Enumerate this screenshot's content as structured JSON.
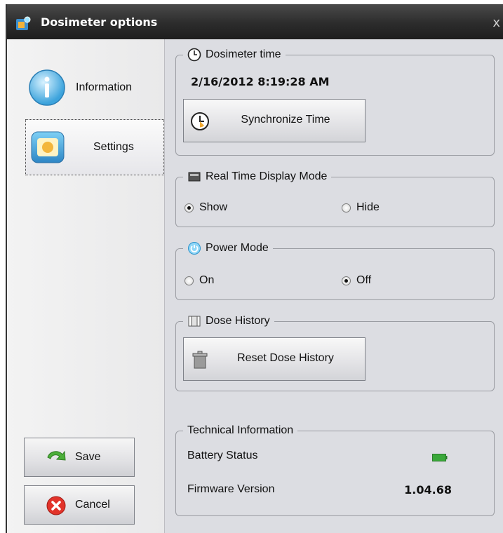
{
  "window": {
    "title": "Dosimeter options",
    "close_glyph": "x"
  },
  "sidebar": {
    "items": [
      {
        "label": "Information",
        "icon": "info-icon",
        "selected": false
      },
      {
        "label": "Settings",
        "icon": "settings-icon",
        "selected": true
      }
    ]
  },
  "buttons": {
    "save_label": "Save",
    "cancel_label": "Cancel"
  },
  "dosimeter_time": {
    "title": "Dosimeter time",
    "value": "2/16/2012 8:19:28 AM",
    "sync_button": "Synchronize Time"
  },
  "realtime_display": {
    "title": "Real Time Display Mode",
    "options": [
      "Show",
      "Hide"
    ],
    "selected": "Show"
  },
  "power_mode": {
    "title": "Power Mode",
    "options": [
      "On",
      "Off"
    ],
    "selected": "Off"
  },
  "dose_history": {
    "title": "Dose History",
    "reset_button": "Reset Dose History"
  },
  "technical": {
    "title": "Technical Information",
    "battery_label": "Battery Status",
    "firmware_label": "Firmware Version",
    "firmware_value": "1.04.68"
  },
  "colors": {
    "battery": "#3aa83a",
    "titlebar": "#2c2c2c",
    "accent_blue": "#3a9fd8"
  }
}
